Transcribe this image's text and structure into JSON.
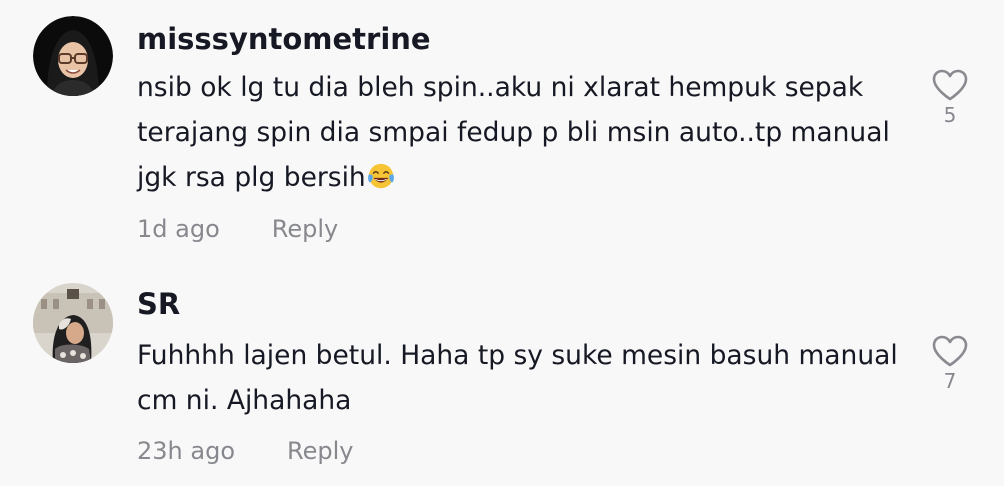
{
  "comments": [
    {
      "username": "misssyntometrine",
      "text": "nsib ok lg tu dia bleh spin..aku ni xlarat hempuk sepak terajang spin dia smpai fedup p bli msin auto..tp manual jgk rsa plg bersih",
      "emoji": "face-with-tears-of-joy",
      "time": "1d ago",
      "reply_label": "Reply",
      "like_count": "5",
      "avatar_icon": "memoji-hijab-glasses-avatar"
    },
    {
      "username": "SR",
      "text": "Fuhhhh lajen betul. Haha tp sy suke mesin basuh manual cm ni. Ajhahaha",
      "time": "23h ago",
      "reply_label": "Reply",
      "like_count": "7",
      "avatar_icon": "photo-avatar"
    }
  ],
  "colors": {
    "background": "#f8f8f8",
    "text": "#161823",
    "secondary": "#8a8b91"
  }
}
